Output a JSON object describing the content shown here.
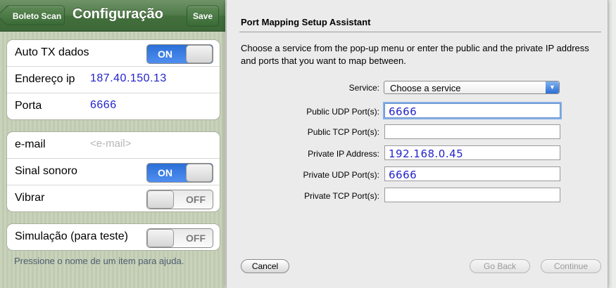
{
  "ios": {
    "nav": {
      "back_label": "Boleto Scan",
      "title": "Configuração",
      "save_label": "Save"
    },
    "group1": {
      "auto_tx": {
        "label": "Auto TX dados",
        "toggle": "ON"
      },
      "ip": {
        "label": "Endereço ip",
        "value": "187.40.150.13"
      },
      "port": {
        "label": "Porta",
        "value": "6666"
      }
    },
    "group2": {
      "email": {
        "label": "e-mail",
        "placeholder": "<e-mail>"
      },
      "sound": {
        "label": "Sinal sonoro",
        "toggle": "ON"
      },
      "vibrate": {
        "label": "Vibrar",
        "toggle": "OFF"
      }
    },
    "group3": {
      "simulation": {
        "label": "Simulação (para teste)",
        "toggle": "OFF"
      }
    },
    "hint": "Pressione o nome de um item para ajuda."
  },
  "sheet": {
    "title": "Port Mapping Setup Assistant",
    "description": "Choose a service from the pop-up menu or enter the public and the private IP address and ports that you want to map between.",
    "service_label": "Service:",
    "service_value": "Choose a service",
    "fields": [
      {
        "label": "Public UDP Port(s):",
        "value": "6666"
      },
      {
        "label": "Public TCP Port(s):",
        "value": ""
      },
      {
        "label": "Private IP Address:",
        "value": "192.168.0.45"
      },
      {
        "label": "Private UDP Port(s):",
        "value": "6666"
      },
      {
        "label": "Private TCP Port(s):",
        "value": ""
      }
    ],
    "buttons": {
      "cancel": "Cancel",
      "go_back": "Go Back",
      "continue": "Continue"
    }
  },
  "colors": {
    "nav_green": "#4f7a48",
    "toggle_on": "#2b6fd6",
    "entered_text": "#2222cc"
  }
}
